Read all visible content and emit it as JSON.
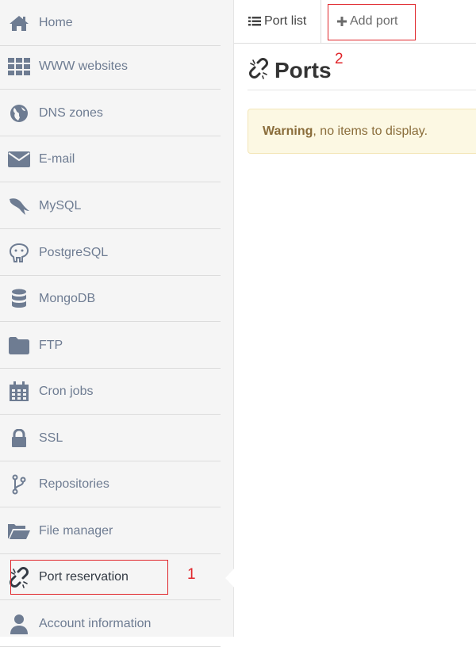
{
  "sidebar": {
    "items": [
      {
        "label": "Home",
        "icon": "home-icon"
      },
      {
        "label": "WWW websites",
        "icon": "grid-icon"
      },
      {
        "label": "DNS zones",
        "icon": "globe-icon"
      },
      {
        "label": "E-mail",
        "icon": "envelope-icon"
      },
      {
        "label": "MySQL",
        "icon": "dolphin-icon"
      },
      {
        "label": "PostgreSQL",
        "icon": "elephant-icon"
      },
      {
        "label": "MongoDB",
        "icon": "database-icon"
      },
      {
        "label": "FTP",
        "icon": "folder-icon"
      },
      {
        "label": "Cron jobs",
        "icon": "calendar-icon"
      },
      {
        "label": "SSL",
        "icon": "lock-icon"
      },
      {
        "label": "Repositories",
        "icon": "branch-icon"
      },
      {
        "label": "File manager",
        "icon": "folder-open-icon"
      },
      {
        "label": "Port reservation",
        "icon": "broken-link-icon",
        "active": true
      },
      {
        "label": "Account information",
        "icon": "user-icon"
      }
    ]
  },
  "tabs": [
    {
      "label": "Port list",
      "icon": "list-icon",
      "active": true
    },
    {
      "label": "Add port",
      "icon": "plus-icon",
      "active": false
    }
  ],
  "page": {
    "title": "Ports",
    "title_icon": "broken-link-icon"
  },
  "alert": {
    "strong": "Warning",
    "text": ", no items to display."
  },
  "annotations": {
    "one": "1",
    "two": "2"
  },
  "colors": {
    "icon": "#6e7c92",
    "annotation": "#e0262b",
    "warning_bg": "#fcf8e3",
    "warning_text": "#8a6d3b"
  }
}
